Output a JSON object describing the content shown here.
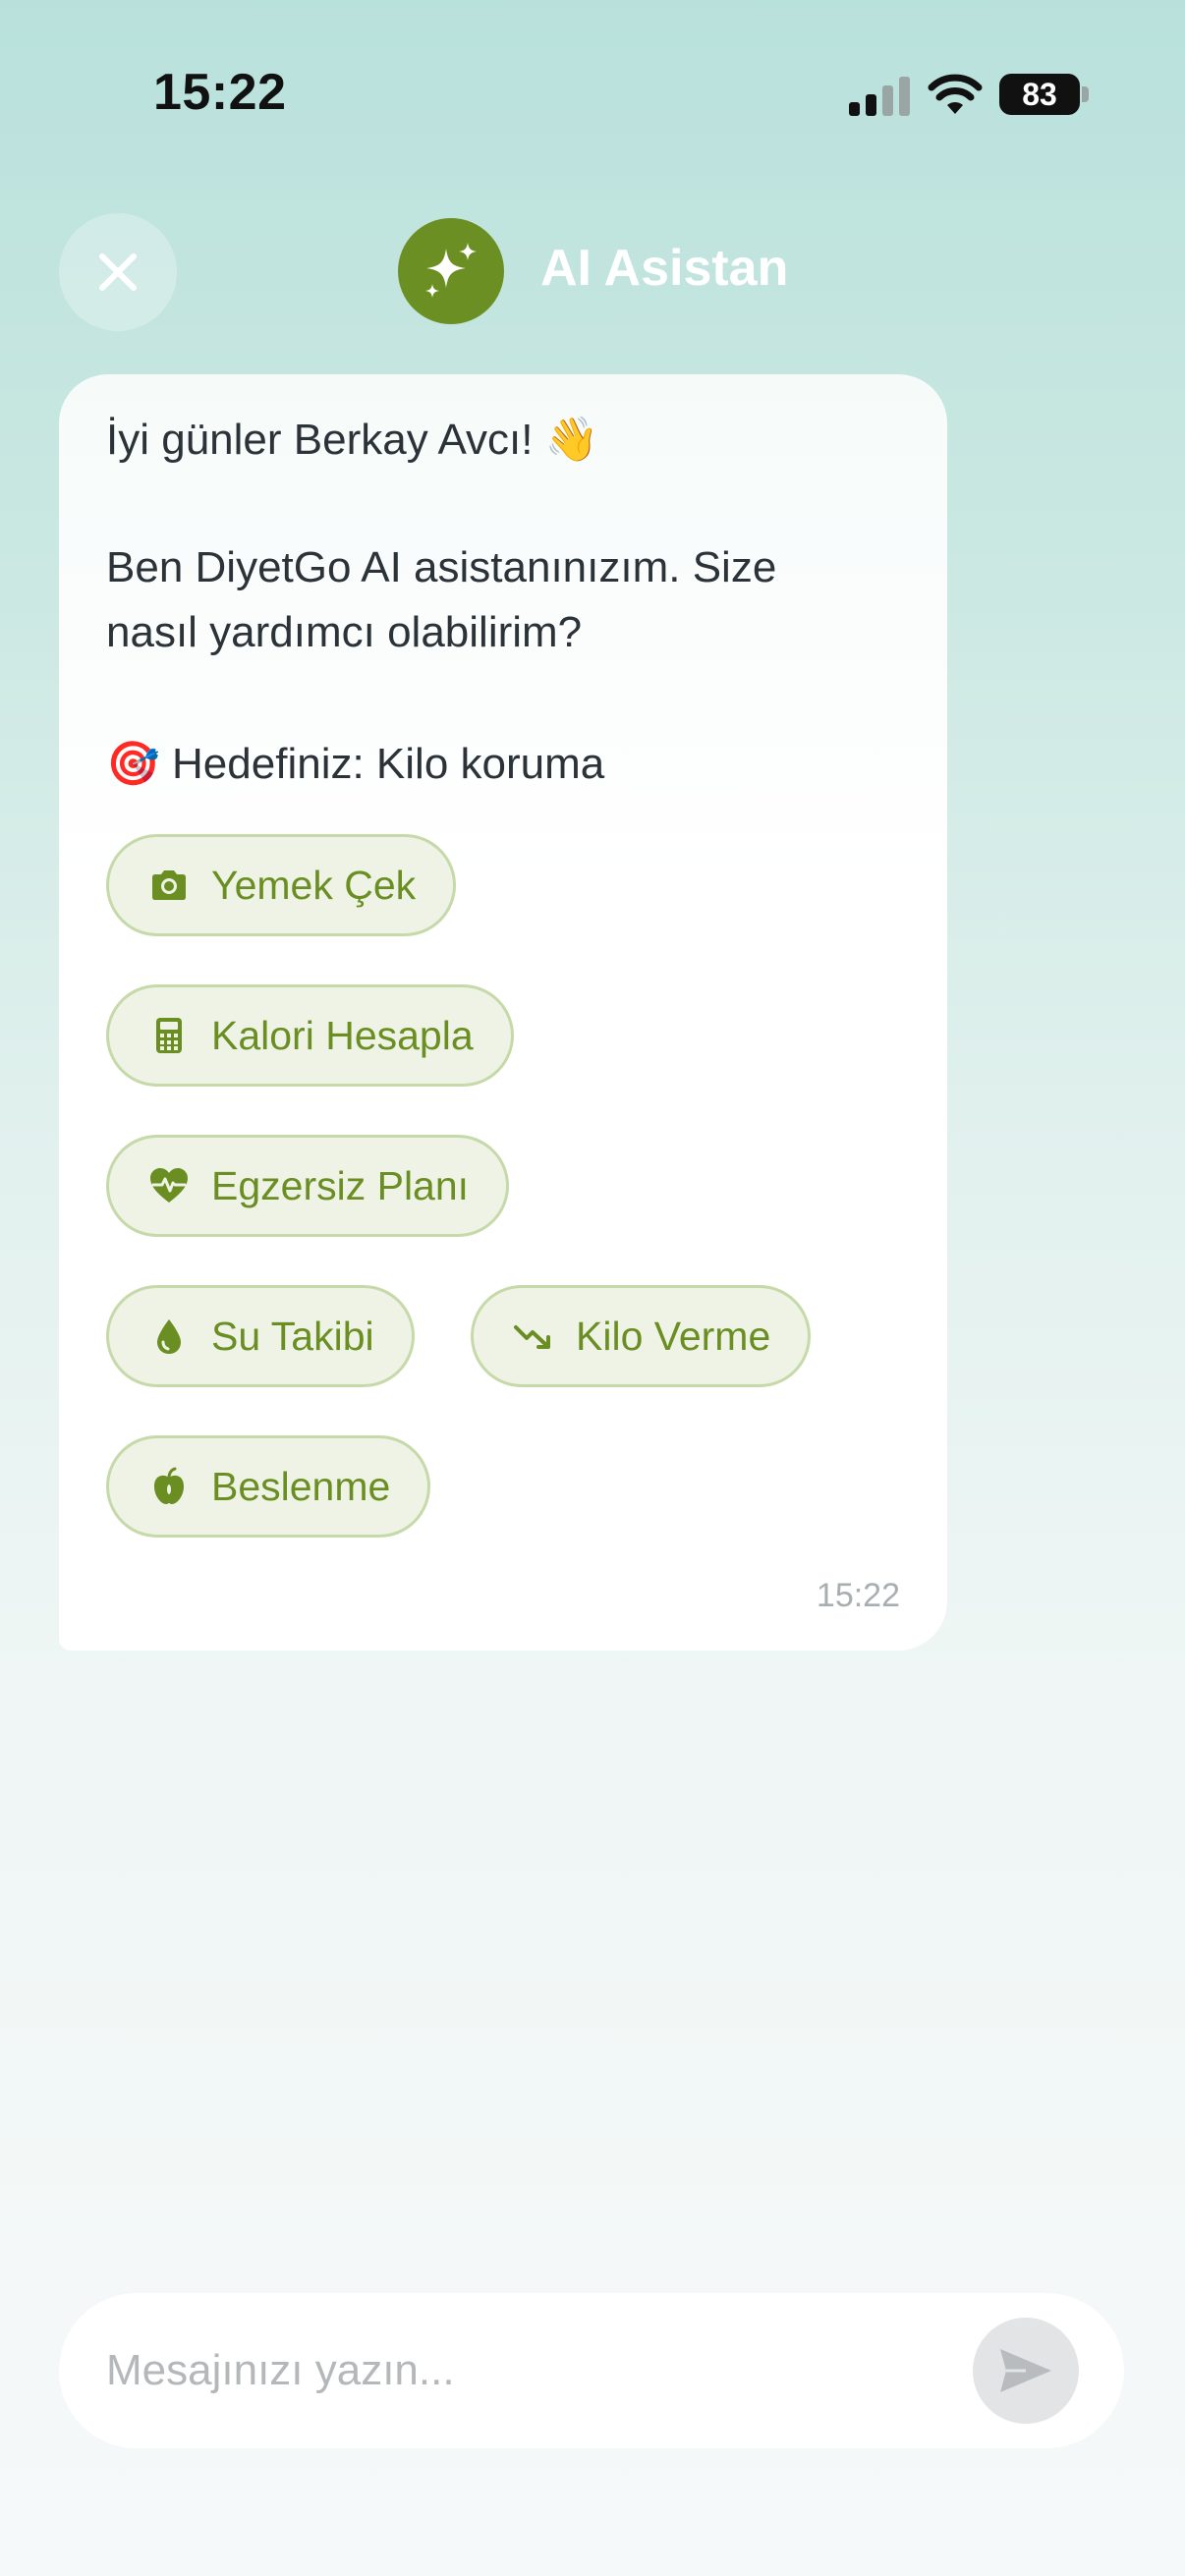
{
  "status_bar": {
    "time": "15:22",
    "battery": "83"
  },
  "header": {
    "title": "AI Asistan",
    "close_icon": "close-icon",
    "avatar_icon": "sparkles-icon"
  },
  "message": {
    "greeting": "İyi günler Berkay Avcı!",
    "greeting_emoji": "👋",
    "intro_line1": "Ben DiyetGo AI asistanınızım. Size",
    "intro_line2": "nasıl yardımcı olabilirim?",
    "goal_emoji": "🎯",
    "goal": "Hedefiniz: Kilo koruma",
    "time": "15:22"
  },
  "quick_actions": [
    {
      "label": "Yemek Çek",
      "icon": "camera-icon"
    },
    {
      "label": "Kalori Hesapla",
      "icon": "calculator-icon"
    },
    {
      "label": "Egzersiz Planı",
      "icon": "heart-pulse-icon"
    },
    {
      "label": "Su Takibi",
      "icon": "water-drop-icon"
    },
    {
      "label": "Kilo Verme",
      "icon": "trend-down-icon"
    },
    {
      "label": "Beslenme",
      "icon": "apple-icon"
    }
  ],
  "composer": {
    "placeholder": "Mesajınızı yazın...",
    "value": ""
  },
  "colors": {
    "accent": "#6b8f22",
    "chip_bg": "#eef3e6",
    "chip_border": "#c6d9a8"
  }
}
